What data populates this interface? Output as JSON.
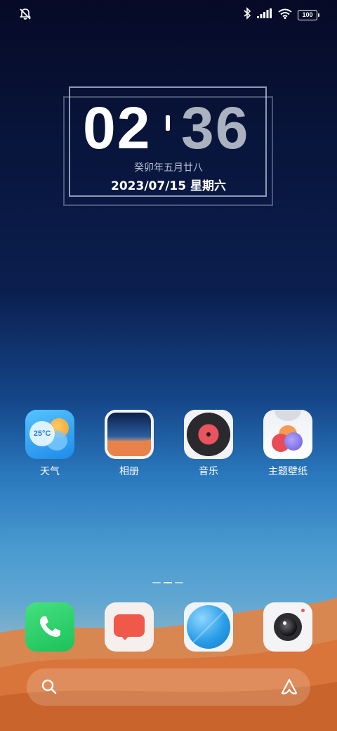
{
  "status_bar": {
    "battery": "100"
  },
  "clock": {
    "hour": "02",
    "minute": "36",
    "lunar_date": "癸卯年五月廿八",
    "date": "2023/07/15 星期六"
  },
  "apps": [
    {
      "label": "天气",
      "icon": "weather-icon",
      "temp": "25°C"
    },
    {
      "label": "相册",
      "icon": "gallery-icon"
    },
    {
      "label": "音乐",
      "icon": "music-icon"
    },
    {
      "label": "主题壁纸",
      "icon": "themes-icon"
    }
  ],
  "page_indicator": {
    "pages": 3,
    "active": 2
  },
  "dock": [
    {
      "icon": "phone-icon"
    },
    {
      "icon": "messages-icon"
    },
    {
      "icon": "browser-icon"
    },
    {
      "icon": "camera-icon"
    }
  ],
  "colors": {
    "phone_green": "#2ed06a",
    "messages_red": "#f0594a",
    "browser_blue": "#2a9ee8",
    "music_red": "#e9545e"
  }
}
